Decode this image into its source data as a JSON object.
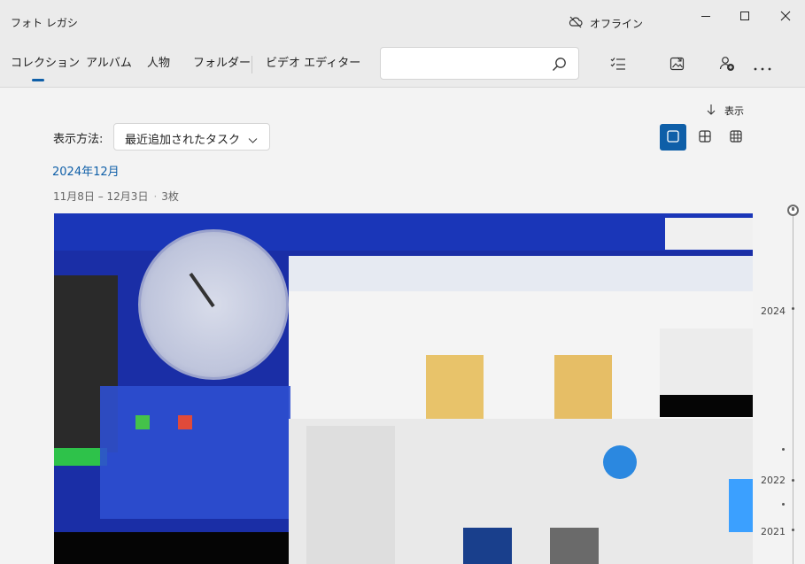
{
  "window": {
    "title": "フォト レガシ",
    "offline_label": "オフライン"
  },
  "tabs": [
    {
      "label": "コレクション",
      "active": true
    },
    {
      "label": "アルバム",
      "active": false
    },
    {
      "label": "人物",
      "active": false
    },
    {
      "label": "フォルダー",
      "active": false
    },
    {
      "label": "ビデオ エディター",
      "active": false
    }
  ],
  "search": {
    "value": "",
    "placeholder": ""
  },
  "toolbar": {
    "buttons": [
      "select-icon",
      "import-icon",
      "add-person-icon",
      "more-icon"
    ]
  },
  "sort": {
    "label": "表示"
  },
  "view": {
    "label": "表示方法:",
    "selected": "最近追加されたタスク"
  },
  "size_buttons": [
    "single-square-icon",
    "medium-grid-icon",
    "small-grid-icon"
  ],
  "group": {
    "month": "2024年12月",
    "range": "11月8日 – 12月3日",
    "count": "3枚"
  },
  "timeline": {
    "years": [
      "2024",
      "2022",
      "2021"
    ]
  },
  "colors": {
    "accent": "#0f5fa8",
    "header_bg": "#ebebeb",
    "page_bg": "#f3f3f3"
  }
}
